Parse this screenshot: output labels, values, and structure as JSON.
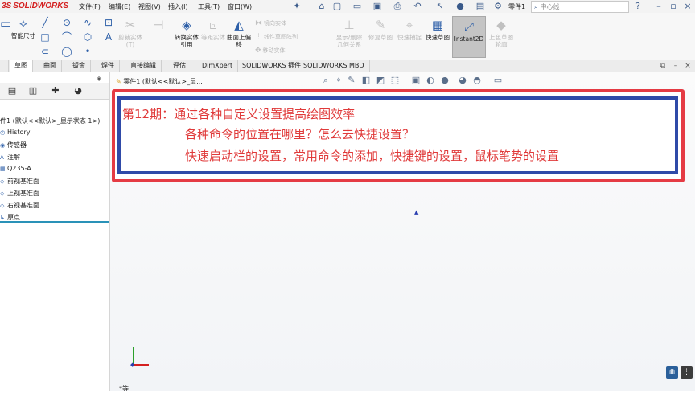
{
  "app": {
    "logo_ds": "3S",
    "logo_name": "SOLIDWORKS"
  },
  "menu": [
    "文件(F)",
    "编辑(E)",
    "视图(V)",
    "插入(I)",
    "工具(T)",
    "窗口(W)"
  ],
  "titlebar": {
    "doc_name": "零件1",
    "search_placeholder": "中心线"
  },
  "ribbon": {
    "smart_dimension": "智能尺寸",
    "items": [
      {
        "label": "剪裁实体(T)"
      },
      {
        "label": "转换实体引用"
      },
      {
        "label": "等距实体"
      },
      {
        "label": "曲面上偏移"
      },
      {
        "label": "显示/删除几何关系"
      },
      {
        "label": "修复草图"
      },
      {
        "label": "快速捕捉"
      },
      {
        "label": "快速草图"
      },
      {
        "label": "Instant2D"
      },
      {
        "label": "上色草图轮廓"
      }
    ],
    "row_labels": [
      "镜向实体",
      "线性草图阵列",
      "移动实体"
    ]
  },
  "tabs": [
    "草图",
    "曲面",
    "钣金",
    "焊件",
    "直接编辑",
    "评估",
    "DimXpert",
    "SOLIDWORKS 插件",
    "SOLIDWORKS MBD"
  ],
  "feature_tree": {
    "root": "件1 (默认<<默认>_显示状态 1>)",
    "items": [
      "History",
      "传感器",
      "注解",
      "Q235-A",
      "前视基准面",
      "上视基准面",
      "右视基准面",
      "原点"
    ]
  },
  "breadcrumb": "零件1 (默认<<默认>_显...",
  "annotation": {
    "title": "第12期：通过各种自定义设置提高绘图效率",
    "line1": "各种命令的位置在哪里？怎么去快捷设置？",
    "line2": "快速启动栏的设置，常用命令的添加，快捷键的设置，鼠标笔势的设置"
  },
  "bottom_label": "*等",
  "colors": {
    "frame_red": "#e53b44",
    "frame_blue": "#2f4aa8",
    "annotation_text": "#e03a3a",
    "brand": "#d42020"
  }
}
